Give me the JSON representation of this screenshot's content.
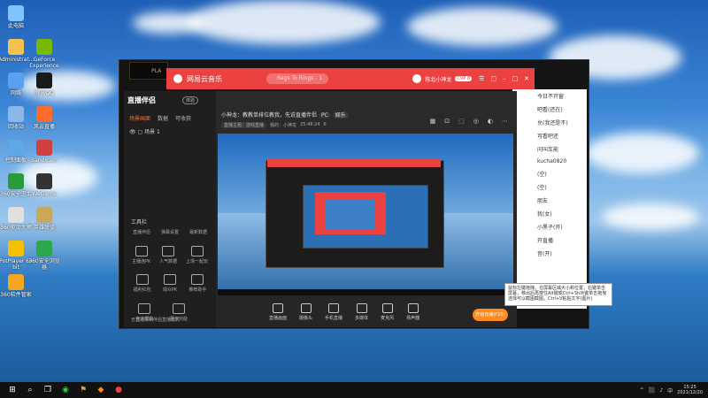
{
  "desktop": {
    "icons": [
      {
        "label": "此电脑",
        "color": "#7fc4ff"
      },
      {
        "label": "Administrat...",
        "color": "#f2c14e"
      },
      {
        "label": "GeForce Experience",
        "color": "#76b900"
      },
      {
        "label": "网络",
        "color": "#5aa0f0"
      },
      {
        "label": "腾讯QQ",
        "color": "#1a1a1a"
      },
      {
        "label": "回收站",
        "color": "#8ab6e8"
      },
      {
        "label": "风云直播",
        "color": "#ff6b2b"
      },
      {
        "label": "控制面板",
        "color": "#5fa8e8"
      },
      {
        "label": "Bandicam",
        "color": "#d04040"
      },
      {
        "label": "360安全卫士",
        "color": "#2a9a3a"
      },
      {
        "label": "WeGame",
        "color": "#333"
      },
      {
        "label": "360驱动大师",
        "color": "#e0e0e0"
      },
      {
        "label": "英雄联盟",
        "color": "#c9a85a"
      },
      {
        "label": "PotPlayer 64 bit",
        "color": "#f5c000"
      },
      {
        "label": "360安全浏览器",
        "color": "#2aa84a"
      },
      {
        "label": "360软件管家",
        "color": "#f5a623"
      }
    ]
  },
  "lol": {
    "tab_label": "PLA"
  },
  "netease": {
    "title": "网易云音乐",
    "search_placeholder": "Rags To Rings - 1",
    "username": "陈北小神龙",
    "vip": "CVP 8",
    "controls": [
      "☰",
      "▢",
      "–",
      "□",
      "✕"
    ]
  },
  "right_panel": {
    "lines": [
      "今日不开窗",
      "吧看(还在)",
      "兑(我还是不)",
      "可看吧还",
      "问叫车能",
      "kucha0820",
      "(空)",
      "(空)",
      "朋友",
      "我(女)",
      "小黑子(开)",
      "开直播",
      "音(开)"
    ]
  },
  "zhibo": {
    "logo": "直播伴侣",
    "badge": "体验",
    "tabs": [
      {
        "label": "场景画面",
        "active": true
      },
      {
        "label": "数据",
        "active": false
      },
      {
        "label": "可收获",
        "active": false
      }
    ],
    "scene_name": "场景 1",
    "tools_title": "工具栏",
    "tools_row1": [
      "直播伴侣",
      "弹幕设置",
      "最新数据"
    ],
    "tools_row2": [
      "主播连PK",
      "人气数据",
      "上场一起玩"
    ],
    "tools_row3": [
      "福利红包",
      "观众PK",
      "推荐助手"
    ],
    "tools_row4": [
      "官方帮助",
      "更多功能",
      ""
    ],
    "footer_text": "无直播限制伴侣直播模式",
    "stream_title": "小神龙：教教单排位教我，先说直播伴侣",
    "tags": [
      "PC",
      "娱乐"
    ],
    "stream_info": [
      "直播主题：游戏直播",
      "我的：小神龙",
      "25:48:24",
      "6"
    ],
    "top_right_icons": [
      "▦",
      "⊡",
      "⬚",
      "◎",
      "◐",
      "⋯"
    ],
    "bottom_tools": [
      "直播画面",
      "摄像头",
      "手机直播",
      "多媒体",
      "麦克风",
      "扬声器"
    ],
    "golive_label": "开始直播(F10)"
  },
  "tooltip": {
    "text": "鼠标左键拖拽，在屏幕区域大小和位置，右键单击屏幕，移出后再按住Alt键或Ctrl+Shift键单击拖曳选择可以截图截图，Ctrl+V粘贴文字(图片)"
  },
  "taskbar": {
    "icons": [
      "⊞",
      "⌕",
      "❐",
      "◉",
      "⚑",
      "◆",
      "●"
    ],
    "tray": [
      "^",
      "⬛",
      "♪",
      "中"
    ],
    "time": "15:25",
    "date": "2021/12/20"
  }
}
